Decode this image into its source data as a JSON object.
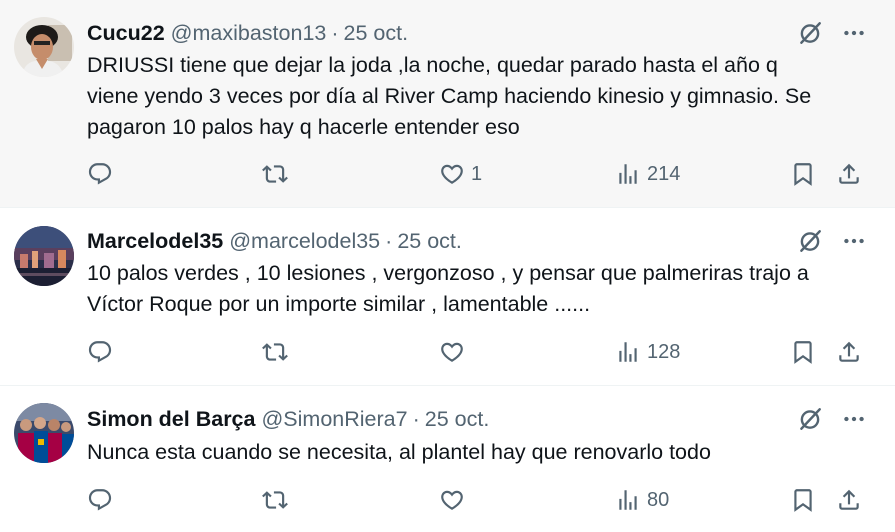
{
  "tweets": [
    {
      "name": "Cucu22",
      "handle": "@maxibaston13",
      "sep": "·",
      "date": "25 oct.",
      "lines": [
        "DRIUSSI tiene que dejar la joda ,la noche, quedar parado hasta el año q",
        "viene yendo 3 veces por día al River Camp haciendo kinesio y gimnasio. Se",
        "pagaron 10 palos hay q hacerle entender eso"
      ],
      "likes": "1",
      "views": "214"
    },
    {
      "name": "Marcelodel35",
      "handle": "@marcelodel35",
      "sep": "·",
      "date": "25 oct.",
      "lines": [
        "10 palos verdes , 10 lesiones , vergonzoso , y pensar que palmeriras  trajo a",
        "Víctor Roque por un importe similar , lamentable ......"
      ],
      "likes": "",
      "views": "128"
    },
    {
      "name": "Simon del Barça",
      "handle": "@SimonRiera7",
      "sep": "·",
      "date": "25 oct.",
      "lines": [
        "Nunca esta cuando se necesita, al plantel hay que renovarlo todo"
      ],
      "likes": "",
      "views": "80"
    }
  ],
  "icons": {
    "reply": "reply-icon",
    "retweet": "retweet-icon",
    "like": "heart-icon",
    "views": "views-icon",
    "bookmark": "bookmark-icon",
    "share": "share-icon",
    "grok": "grok-icon",
    "more": "more-icon"
  },
  "colors": {
    "text": "#0f1419",
    "secondary": "#536471",
    "highlight_bg": "#f7f7f7"
  }
}
